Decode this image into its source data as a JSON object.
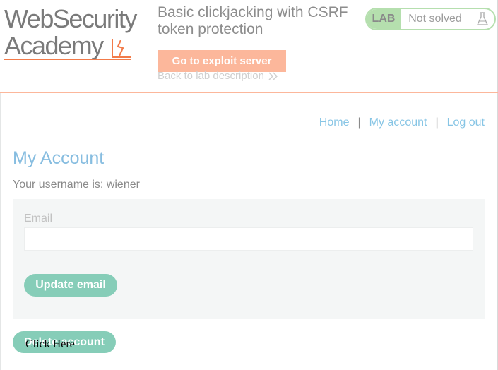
{
  "header": {
    "logo": {
      "line1": "WebSecurity",
      "line2": "Academy"
    },
    "lab_title": "Basic clickjacking with CSRF token protection",
    "exploit_button": "Go to exploit server",
    "back_link": "Back to lab description",
    "lab_badge": {
      "label": "LAB",
      "status": "Not solved",
      "icon": "flask-icon"
    }
  },
  "nav": {
    "items": [
      {
        "label": "Home"
      },
      {
        "label": "My account"
      },
      {
        "label": "Log out"
      }
    ],
    "separator": "|"
  },
  "main": {
    "title": "My Account",
    "username_line": "Your username is: wiener",
    "form": {
      "email_label": "Email",
      "email_value": "",
      "update_button": "Update email"
    },
    "delete_button": "Delete account",
    "decoy_text": "Click Here"
  },
  "colors": {
    "brand_orange": "#f27b4a",
    "exploit_button_bg": "#fcb79b",
    "lab_badge_green": "#b5dfae",
    "link_blue": "#87c5e5",
    "title_blue": "#87bde0",
    "button_teal": "#86cdb8"
  }
}
